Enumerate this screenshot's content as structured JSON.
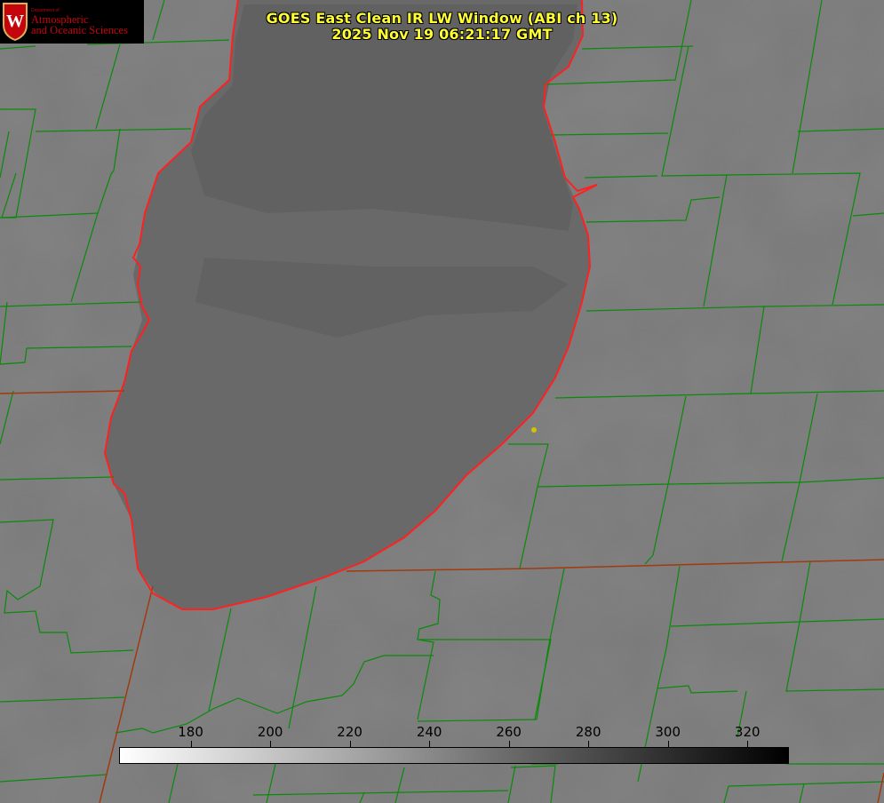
{
  "title": {
    "line1": "GOES East Clean IR LW Window (ABI ch 13)",
    "line2": "2025 Nov 19 06:21:17 GMT"
  },
  "logo": {
    "department": "Department of",
    "line1": "Atmospheric",
    "line2": "and Oceanic Sciences",
    "brand_color": "#c5050c"
  },
  "colorbar": {
    "min": 162,
    "max": 330,
    "ticks": [
      "180",
      "200",
      "220",
      "240",
      "260",
      "280",
      "300",
      "320"
    ],
    "gradient": [
      "#ffffff",
      "#000000"
    ]
  },
  "map": {
    "background_gray": "#7a7a7a",
    "lake_gray": "#6a6a6a",
    "county_line_color": "#008000",
    "state_line_color": "#b03010",
    "shoreline_color": "#ff2020",
    "station_dot_color": "#d4c400"
  }
}
